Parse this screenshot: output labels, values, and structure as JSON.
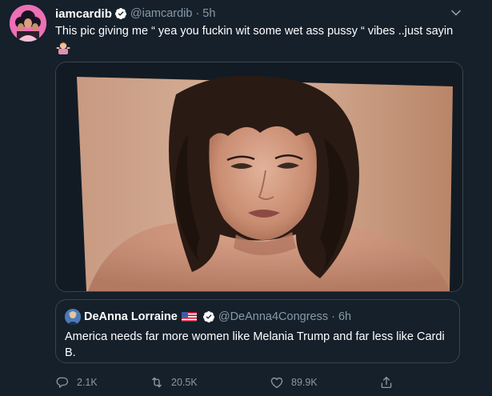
{
  "tweet": {
    "name": "iamcardib",
    "handle": "@iamcardib",
    "separator": "·",
    "time": "5h",
    "text": "This pic giving me “ yea you fuckin wit some wet ass pussy “ vibes ..just sayin",
    "emoji": "person-shrugging"
  },
  "quoted_tweet": {
    "name": "DeAnna Lorraine",
    "handle": "@DeAnna4Congress",
    "separator": "·",
    "time": "6h",
    "text": "America needs far more women like Melania Trump and far less like Cardi B."
  },
  "actions": {
    "reply_count": "2.1K",
    "retweet_count": "20.5K",
    "like_count": "89.9K"
  },
  "colors": {
    "background": "#15202b",
    "border": "#38444d",
    "muted_text": "#8899a6",
    "text": "#ffffff"
  },
  "icons": [
    "chevron-down-icon",
    "verified-badge-icon",
    "us-flag-icon",
    "reply-icon",
    "retweet-icon",
    "like-icon",
    "share-icon"
  ]
}
